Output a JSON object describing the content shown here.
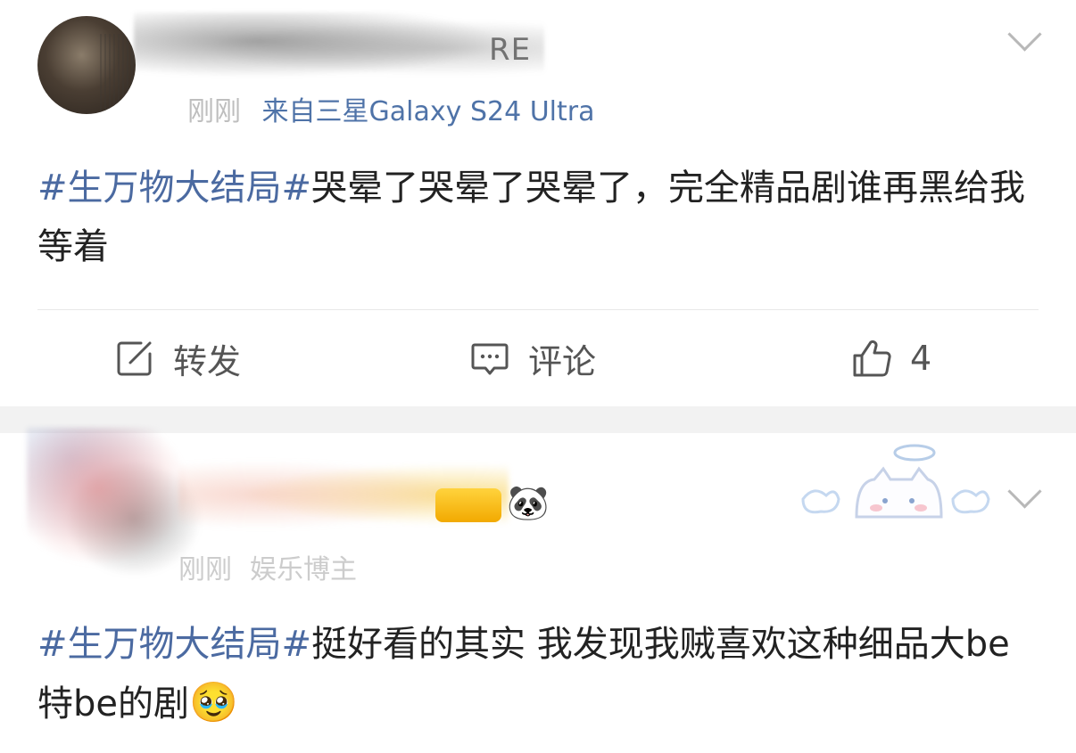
{
  "post1": {
    "time": "刚刚",
    "source": "来自三星Galaxy S24 Ultra",
    "name_fragment": "RE",
    "hashtag": "#生万物大结局#",
    "body": "哭晕了哭晕了哭晕了，完全精品剧谁再黑给我等着",
    "actions": {
      "repost": "转发",
      "comment": "评论",
      "like_count": "4"
    }
  },
  "post2": {
    "time": "刚刚",
    "source": "娱乐博主",
    "badge_icon": "panda-icon",
    "hashtag": "#生万物大结局#",
    "body": "挺好看的其实 我发现我贼喜欢这种细品大be特be的剧",
    "emoji": "🥹"
  },
  "icons": {
    "chevron": "chevron-down-icon",
    "repost": "edit-square-icon",
    "comment": "comment-bubble-icon",
    "like": "thumbs-up-icon"
  },
  "colors": {
    "hashtag": "#4b6aa1",
    "device": "#4f73a8",
    "separator": "#f2f2f2"
  }
}
